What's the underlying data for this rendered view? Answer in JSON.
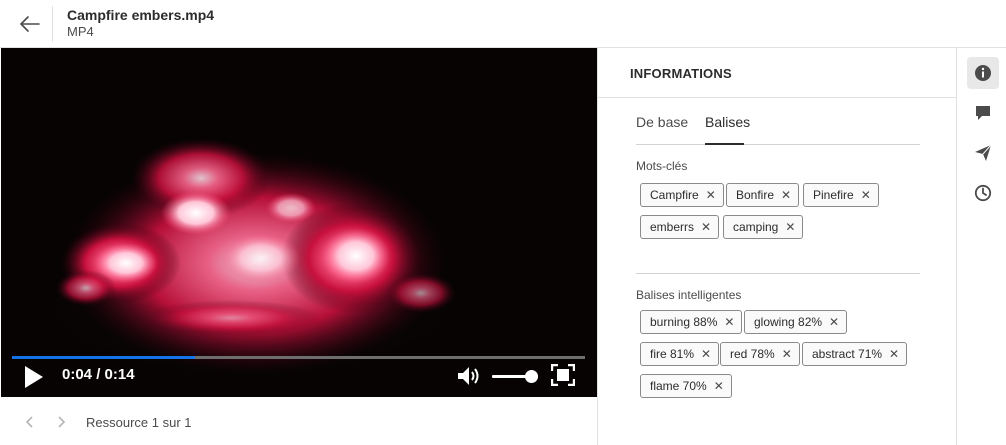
{
  "header": {
    "title": "Campfire embers.mp4",
    "subtitle": "MP4",
    "back_icon": "arrow-left-icon"
  },
  "player": {
    "time": "0:04 / 0:14",
    "progress_fraction": 0.32,
    "volume_fraction": 0.85,
    "accent_color": "#1473e6",
    "icons": [
      "play-icon",
      "volume-icon",
      "fullscreen-icon"
    ]
  },
  "pager": {
    "count_text": "Ressource 1 sur 1"
  },
  "panel": {
    "title": "INFORMATIONS",
    "tabs": [
      {
        "label": "De base",
        "active": false
      },
      {
        "label": "Balises",
        "active": true
      }
    ],
    "keywords_label": "Mots-clés",
    "keywords": [
      "Campfire",
      "Bonfire",
      "Pinefire",
      "emberrs",
      "camping"
    ],
    "smart_tags_label": "Balises intelligentes",
    "smart_tags": [
      "burning 88%",
      "glowing 82%",
      "fire 81%",
      "red 78%",
      "abstract 71%",
      "flame 70%"
    ],
    "remove_glyph": "✕"
  },
  "rail": {
    "icons": [
      "info-icon",
      "comment-icon",
      "share-icon",
      "history-icon"
    ],
    "active": "info-icon"
  }
}
